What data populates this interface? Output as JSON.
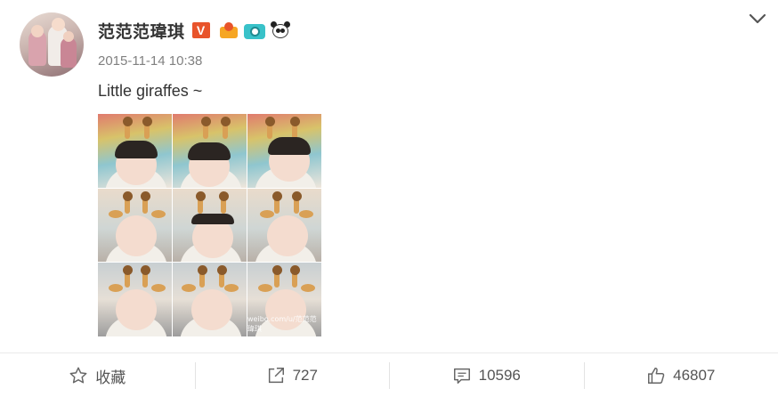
{
  "post": {
    "author": "范范范瑋琪",
    "badges": [
      "verified-v-badge",
      "vip-crown-badge",
      "camera-badge",
      "panda-badge"
    ],
    "verified_label": "V",
    "timestamp": "2015-11-14 10:38",
    "text": "Little giraffes ~",
    "photo": {
      "grid": "3x3",
      "subject": "baby with giraffe horn headband",
      "watermark": "weibo.com/u/范范范瑋琪"
    }
  },
  "actions": {
    "favorite_label": "收藏",
    "repost_count": "727",
    "comment_count": "10596",
    "like_count": "46807"
  },
  "colors": {
    "verified": "#e8542b",
    "text": "#333333",
    "muted": "#808080",
    "divider": "#eaeaea"
  }
}
